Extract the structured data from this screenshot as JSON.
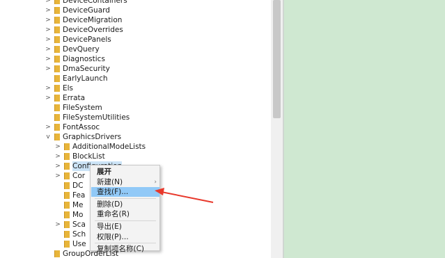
{
  "tree": {
    "items": [
      {
        "label": "DeviceContainers",
        "level": 0,
        "chev": ">"
      },
      {
        "label": "DeviceGuard",
        "level": 0,
        "chev": ">"
      },
      {
        "label": "DeviceMigration",
        "level": 0,
        "chev": ">"
      },
      {
        "label": "DeviceOverrides",
        "level": 0,
        "chev": ">"
      },
      {
        "label": "DevicePanels",
        "level": 0,
        "chev": ">"
      },
      {
        "label": "DevQuery",
        "level": 0,
        "chev": ">"
      },
      {
        "label": "Diagnostics",
        "level": 0,
        "chev": ">"
      },
      {
        "label": "DmaSecurity",
        "level": 0,
        "chev": ">"
      },
      {
        "label": "EarlyLaunch",
        "level": 0,
        "chev": ""
      },
      {
        "label": "Els",
        "level": 0,
        "chev": ">"
      },
      {
        "label": "Errata",
        "level": 0,
        "chev": ">"
      },
      {
        "label": "FileSystem",
        "level": 0,
        "chev": ""
      },
      {
        "label": "FileSystemUtilities",
        "level": 0,
        "chev": ""
      },
      {
        "label": "FontAssoc",
        "level": 0,
        "chev": ">"
      },
      {
        "label": "GraphicsDrivers",
        "level": 0,
        "chev": "v"
      },
      {
        "label": "AdditionalModeLists",
        "level": 1,
        "chev": ">"
      },
      {
        "label": "BlockList",
        "level": 1,
        "chev": ">"
      },
      {
        "label": "Configuration",
        "level": 1,
        "chev": ">",
        "selected": true
      },
      {
        "label": "Cor",
        "level": 1,
        "chev": ">"
      },
      {
        "label": "DC",
        "level": 1,
        "chev": ""
      },
      {
        "label": "Fea",
        "level": 1,
        "chev": ""
      },
      {
        "label": "Me",
        "level": 1,
        "chev": ""
      },
      {
        "label": "Mo",
        "level": 1,
        "chev": ""
      },
      {
        "label": "Sca",
        "level": 1,
        "chev": ">"
      },
      {
        "label": "Sch",
        "level": 1,
        "chev": ""
      },
      {
        "label": "Use",
        "level": 1,
        "chev": ""
      },
      {
        "label": "GroupOrderList",
        "level": 0,
        "chev": ""
      }
    ]
  },
  "context_menu": {
    "items": [
      {
        "label": "展开",
        "bold": true
      },
      {
        "label": "新建(N)",
        "submenu": true
      },
      {
        "label": "查找(F)...",
        "highlighted": true
      },
      {
        "separator": true
      },
      {
        "label": "删除(D)"
      },
      {
        "label": "重命名(R)"
      },
      {
        "separator": true
      },
      {
        "label": "导出(E)"
      },
      {
        "label": "权限(P)..."
      },
      {
        "separator": true
      },
      {
        "label": "复制项名称(C)"
      }
    ]
  },
  "annotation": {
    "type": "arrow",
    "color": "#e8382b"
  },
  "colors": {
    "folder": "#e8b53a",
    "right_pane": "#cfe8d1",
    "menu_highlight": "#91c9f7",
    "selection": "#cce4f7"
  }
}
